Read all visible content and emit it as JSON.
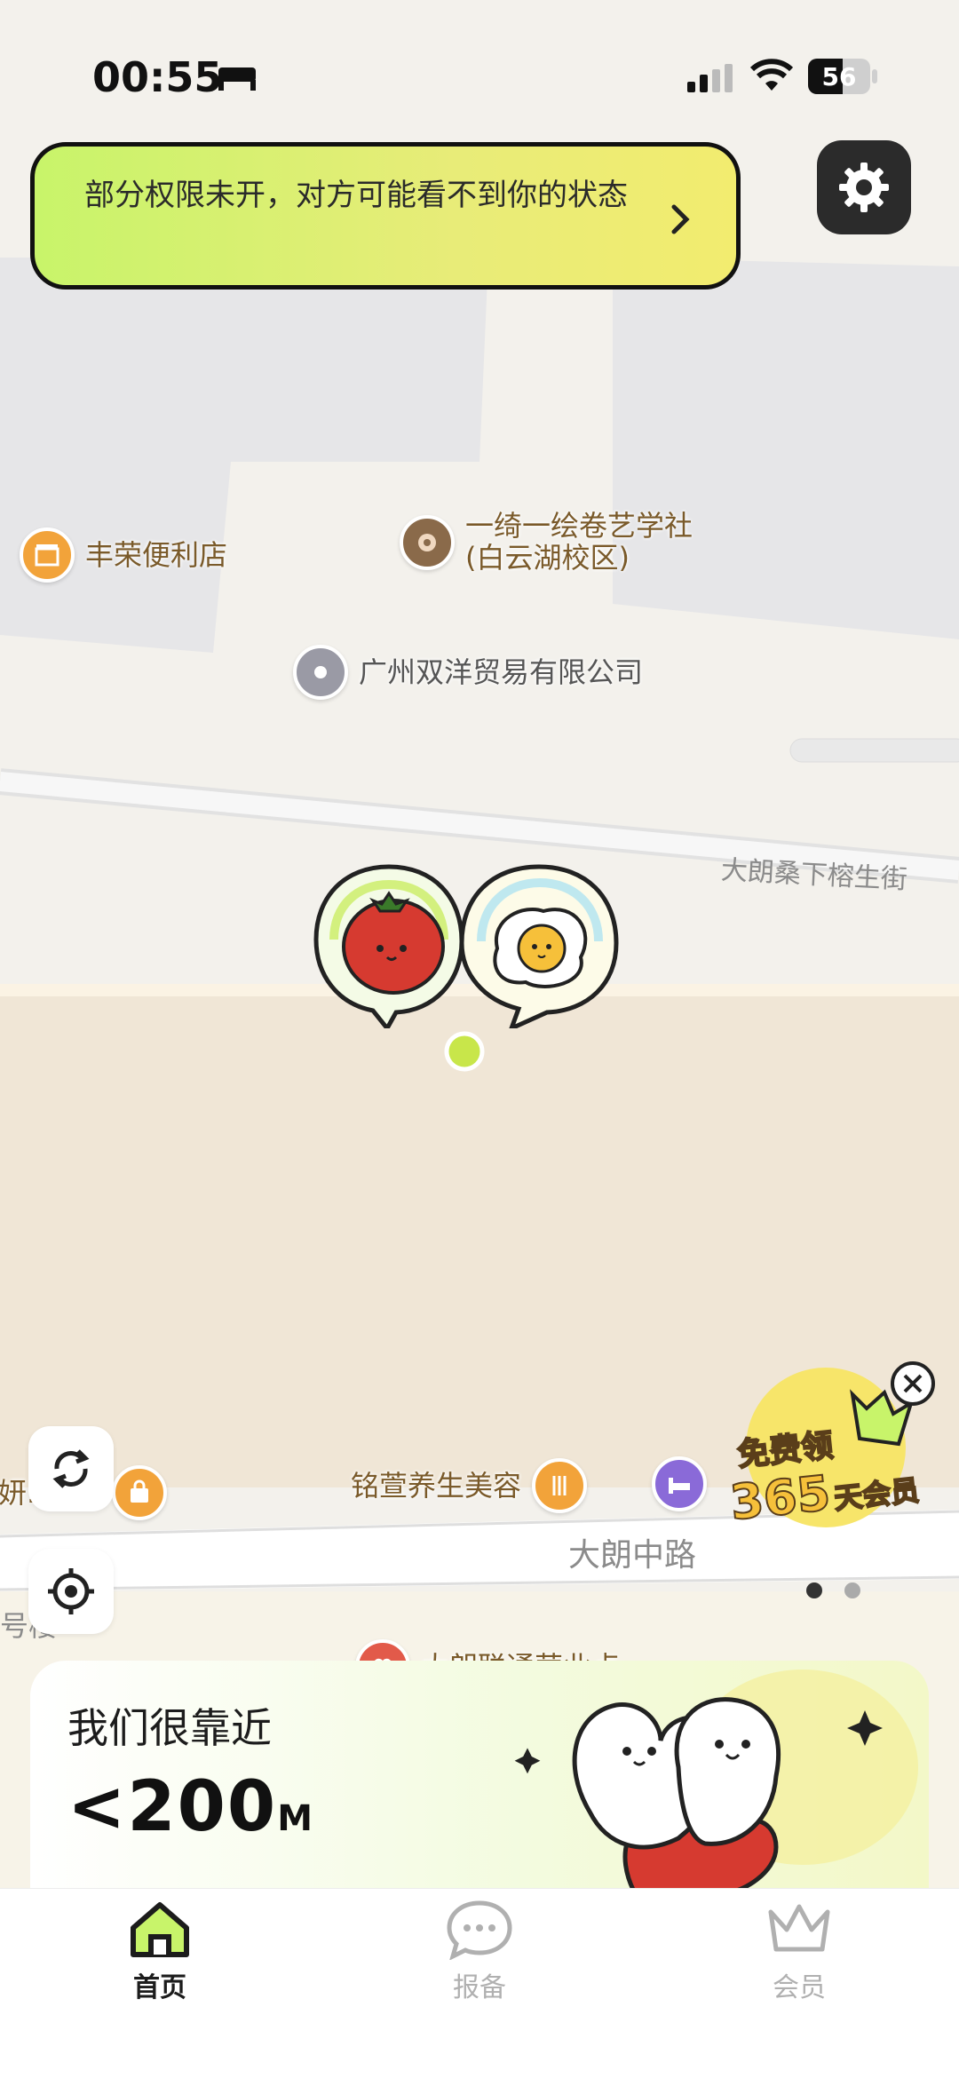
{
  "status_bar": {
    "time": "00:55",
    "battery": "56"
  },
  "banner": {
    "text": "部分权限未开，对方可能看不到你的状态"
  },
  "map": {
    "pois": [
      {
        "name": "丰荣便利店",
        "icon": "store-icon",
        "color": "#f2a33a"
      },
      {
        "name": "一绮一绘卷艺学社\n(白云湖校区)",
        "icon": "donut-icon",
        "color": "#8a6a4a"
      },
      {
        "name": "广州双洋贸易有限公司",
        "icon": "location-dot-icon",
        "color": "#9a9aa5"
      },
      {
        "name": "铭萱养生美容",
        "icon": "beauty-icon",
        "color": "#f2a33a"
      },
      {
        "name": "妍.   商行",
        "icon": "shopping-bag-icon",
        "color": "#f2a33a"
      },
      {
        "name": "大朗联通营业点",
        "icon": "heart-icon",
        "color": "#e25a4a"
      }
    ],
    "roads": [
      "大朗桑下榕生街",
      "大朗中路",
      "号楼"
    ],
    "avatars": [
      "tomato-avatar",
      "fried-egg-avatar"
    ]
  },
  "promo": {
    "line1": "免费领",
    "line2": "365",
    "line3": "天会员"
  },
  "distance_card": {
    "title": "我们很靠近",
    "distance": "<200",
    "unit": "M"
  },
  "tabs": [
    {
      "label": "首页",
      "icon": "home-icon",
      "active": true
    },
    {
      "label": "报备",
      "icon": "chat-bubble-icon",
      "active": false
    },
    {
      "label": "会员",
      "icon": "crown-icon",
      "active": false
    }
  ],
  "colors": {
    "accent_green": "#c8f46a",
    "active_tab": "#1c1c1c",
    "inactive_tab": "#b0b0b0"
  }
}
